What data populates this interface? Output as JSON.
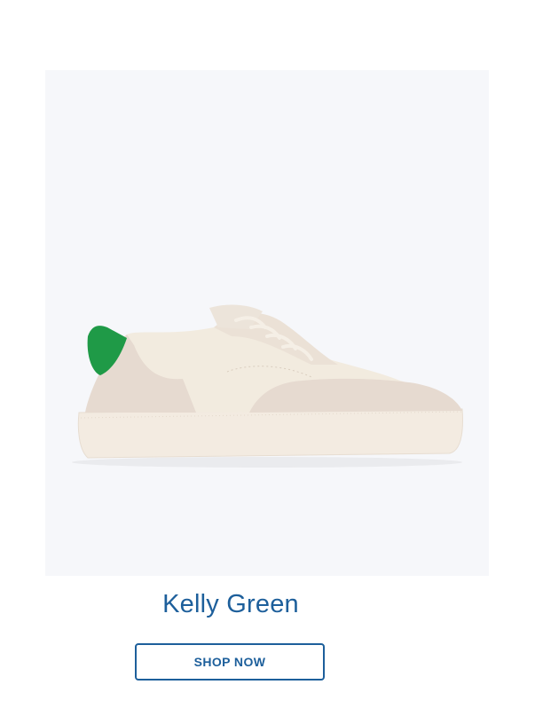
{
  "product": {
    "color_name": "Kelly Green",
    "image_icon": "sneaker-image",
    "accent_color": "#1d5f9b",
    "heel_color": "#1f9a47"
  },
  "cta": {
    "label": "SHOP NOW"
  }
}
